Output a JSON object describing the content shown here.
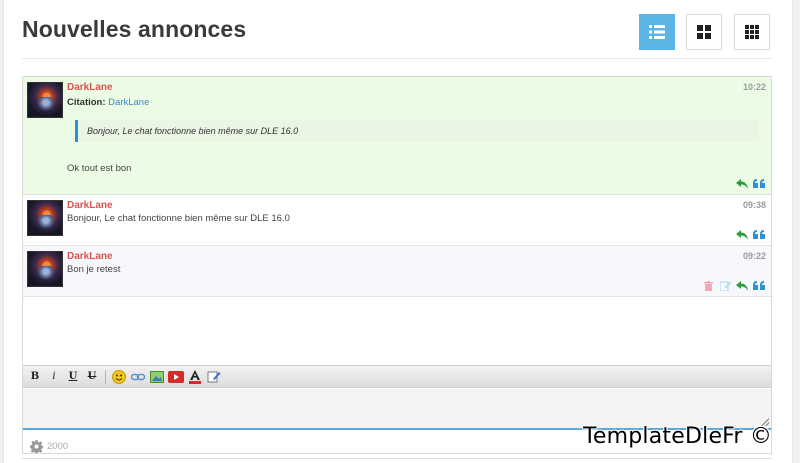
{
  "header": {
    "title": "Nouvelles annonces",
    "view_buttons": [
      {
        "icon": "list-view-icon",
        "active": true
      },
      {
        "icon": "grid-2x2-icon",
        "active": false
      },
      {
        "icon": "grid-3x3-icon",
        "active": false
      }
    ]
  },
  "messages": [
    {
      "author": "DarkLane",
      "time": "10:22",
      "citation_label": "Citation:",
      "citation_author": "DarkLane",
      "quote": "Bonjour, Le chat fonctionne bien même sur DLE 16.0",
      "text": "Ok tout est bon",
      "actions": [
        "reply-icon",
        "quote-icon"
      ]
    },
    {
      "author": "DarkLane",
      "time": "09:38",
      "text": "Bonjour, Le chat fonctionne bien même sur DLE 16.0",
      "actions": [
        "reply-icon",
        "quote-icon"
      ]
    },
    {
      "author": "DarkLane",
      "time": "09:22",
      "text": "Bon je retest",
      "actions": [
        "delete-icon",
        "edit-icon",
        "reply-icon",
        "quote-icon"
      ]
    }
  ],
  "toolbar": {
    "bold": "B",
    "italic": "i",
    "underline": "U",
    "strike": "U"
  },
  "footer": {
    "counter": "2000",
    "watermark": "TemplateDleFr ©"
  },
  "colors": {
    "accent": "#5ab4e4",
    "author": "#d9534f",
    "highlight_bg": "#ecfbe3",
    "reply": "#2e9b3e",
    "quote": "#2f8fd6"
  }
}
